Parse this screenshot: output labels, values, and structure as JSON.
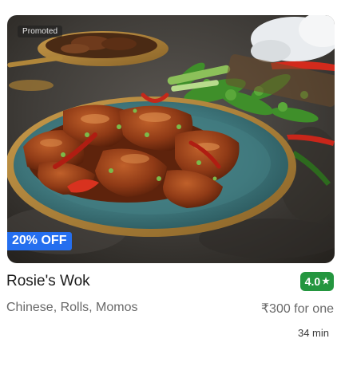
{
  "restaurant": {
    "promoted_label": "Promoted",
    "offer_label": "20% OFF",
    "name": "Rosie's Wok",
    "rating": "4.0",
    "rating_icon": "star-icon",
    "cuisines": "Chinese, Rolls, Momos",
    "price": "₹300 for one",
    "delivery_time": "34 min"
  },
  "colors": {
    "rating_green": "#24963f",
    "offer_blue": "#256fef",
    "name_text": "#1c1c1c",
    "secondary_text": "#696969"
  }
}
